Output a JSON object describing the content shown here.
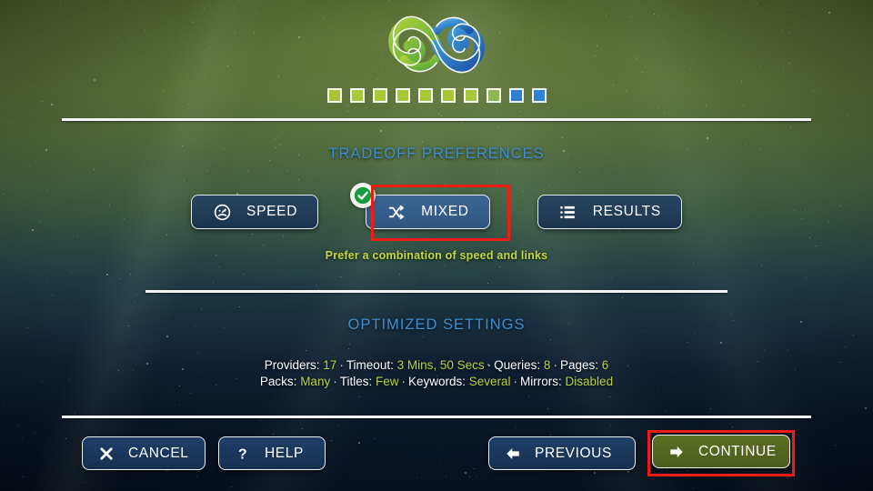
{
  "app": {
    "logo_name": "infinity-swirl-logo"
  },
  "progress": {
    "steps": [
      {
        "state": "done",
        "color": "#a9c23a"
      },
      {
        "state": "done",
        "color": "#a9c83a"
      },
      {
        "state": "done",
        "color": "#aacb35"
      },
      {
        "state": "done",
        "color": "#a8c934"
      },
      {
        "state": "done",
        "color": "#a9c836"
      },
      {
        "state": "done",
        "color": "#a6c733"
      },
      {
        "state": "done",
        "color": "#a5c93b"
      },
      {
        "state": "current",
        "color": "#8cb84e"
      },
      {
        "state": "todo",
        "color": "#2f7fd0"
      },
      {
        "state": "todo",
        "color": "#2f83d6"
      }
    ]
  },
  "tradeoff": {
    "title": "TRADEOFF PREFERENCES",
    "description": "Prefer a combination of speed and links",
    "options": [
      {
        "label": "SPEED",
        "icon": "speedometer-icon",
        "selected": false
      },
      {
        "label": "MIXED",
        "icon": "shuffle-icon",
        "selected": true
      },
      {
        "label": "RESULTS",
        "icon": "list-icon",
        "selected": false
      }
    ]
  },
  "optimized": {
    "title": "OPTIMIZED SETTINGS",
    "separator": "·",
    "line1": [
      {
        "label": "Providers:",
        "value": "17"
      },
      {
        "label": "Timeout:",
        "value": "3 Mins, 50 Secs"
      },
      {
        "label": "Queries:",
        "value": "8"
      },
      {
        "label": "Pages:",
        "value": "6"
      }
    ],
    "line2": [
      {
        "label": "Packs:",
        "value": "Many"
      },
      {
        "label": "Titles:",
        "value": "Few"
      },
      {
        "label": "Keywords:",
        "value": "Several"
      },
      {
        "label": "Mirrors:",
        "value": "Disabled"
      }
    ]
  },
  "footer": {
    "cancel": {
      "label": "CANCEL",
      "icon": "close-x-icon"
    },
    "help": {
      "label": "HELP",
      "icon": "question-mark-icon"
    },
    "previous": {
      "label": "PREVIOUS",
      "icon": "arrow-left-icon"
    },
    "continue": {
      "label": "CONTINUE",
      "icon": "arrow-right-icon"
    }
  },
  "highlights": {
    "color": "#ef1b17",
    "targets": [
      "mixed-option-button",
      "continue-button"
    ]
  },
  "colors": {
    "section_title": "#3f8ed1",
    "value_green": "#b8d140",
    "desc_green": "#c3d940",
    "button_blue": "#1e3f68",
    "continue_green": "#5b6f23",
    "highlight_red": "#ef1b17"
  }
}
